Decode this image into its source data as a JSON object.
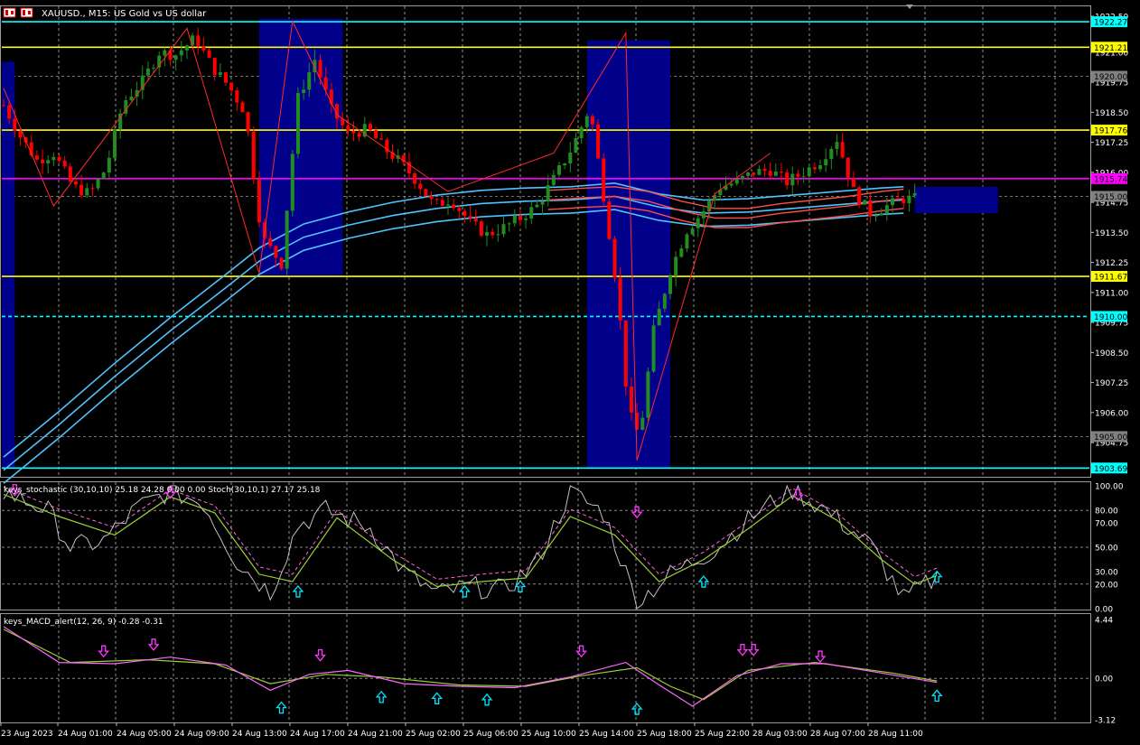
{
  "window": {
    "title": "XAUUSD., M15:  US Gold vs US dollar",
    "symbol_icon": "chart-window-icon"
  },
  "colors": {
    "background": "#000000",
    "grid": "#c0c0c0",
    "bull_candle": "#228b22",
    "bear_candle": "#ff0000",
    "zone": "#00008b",
    "level_yellow": "#ffff00",
    "level_magenta": "#ff00ff",
    "level_cyan": "#00ffff",
    "ema_red": "#ff4d4d",
    "ema_blue": "#4fc3ff",
    "zigzag": "#ff2a2a",
    "stoch_main": "#c0c0c0",
    "stoch_signal": "#9acd32",
    "stoch_slow": "#ff66cc",
    "macd_main": "#ff66ff",
    "macd_signal": "#9acd32",
    "arrow_up": "#00e5ff",
    "arrow_down": "#ff33ff"
  },
  "chart_data": [
    {
      "type": "line",
      "panel": "price",
      "title": "XAUUSD., M15:  US Gold vs US dollar",
      "ylim": [
        1903.4,
        1922.8
      ],
      "price_ticks": [
        "1922.50",
        "1921.00",
        "1919.75",
        "1918.50",
        "1917.25",
        "1916.00",
        "1914.75",
        "1913.50",
        "1912.25",
        "1911.00",
        "1909.75",
        "1908.50",
        "1907.25",
        "1906.00",
        "1904.75"
      ],
      "price_tick_values": [
        1922.5,
        1921.0,
        1919.75,
        1918.5,
        1917.25,
        1916.0,
        1914.75,
        1913.5,
        1912.25,
        1911.0,
        1909.75,
        1908.5,
        1907.25,
        1906.0,
        1904.75
      ],
      "levels": [
        {
          "price": 1922.27,
          "label": "1922.27",
          "color": "cyan",
          "style": "solid"
        },
        {
          "price": 1921.21,
          "label": "1921.21",
          "color": "yellow",
          "style": "solid"
        },
        {
          "price": 1920.0,
          "label": "1920.00",
          "color": "gray",
          "style": "dashed"
        },
        {
          "price": 1917.76,
          "label": "1917.76",
          "color": "yellow",
          "style": "solid"
        },
        {
          "price": 1915.74,
          "label": "1915.74",
          "color": "magenta",
          "style": "solid"
        },
        {
          "price": 1915.0,
          "label": "1915.00",
          "color": "gray",
          "style": "dashed"
        },
        {
          "price": 1911.67,
          "label": "1911.67",
          "color": "yellow",
          "style": "solid"
        },
        {
          "price": 1910.0,
          "label": "1910.00",
          "color": "cyan",
          "style": "dashed"
        },
        {
          "price": 1905.0,
          "label": "1905.00",
          "color": "gray",
          "style": "dashed"
        },
        {
          "price": 1903.69,
          "label": "1903.69",
          "color": "cyan",
          "style": "solid"
        }
      ],
      "close_path": [
        [
          0,
          1918.8
        ],
        [
          6,
          1917.5
        ],
        [
          12,
          1916.5
        ],
        [
          18,
          1916.8
        ],
        [
          25,
          1915.4
        ],
        [
          31,
          1915.1
        ],
        [
          37,
          1916.2
        ],
        [
          43,
          1918.9
        ],
        [
          50,
          1919.8
        ],
        [
          56,
          1921.0
        ],
        [
          62,
          1920.9
        ],
        [
          69,
          1921.6
        ],
        [
          75,
          1920.4
        ],
        [
          81,
          1919.6
        ],
        [
          87,
          1918.5
        ],
        [
          93,
          1913.3
        ],
        [
          100,
          1912.2
        ],
        [
          106,
          1919.1
        ],
        [
          112,
          1920.7
        ],
        [
          118,
          1918.6
        ],
        [
          124,
          1917.6
        ],
        [
          131,
          1917.8
        ],
        [
          137,
          1917.0
        ],
        [
          143,
          1916.4
        ],
        [
          149,
          1915.6
        ],
        [
          155,
          1914.6
        ],
        [
          161,
          1914.9
        ],
        [
          168,
          1913.9
        ],
        [
          174,
          1913.4
        ],
        [
          180,
          1913.7
        ],
        [
          186,
          1914.1
        ],
        [
          192,
          1914.6
        ],
        [
          199,
          1915.9
        ],
        [
          205,
          1917.1
        ],
        [
          211,
          1918.7
        ],
        [
          217,
          1914.3
        ],
        [
          221,
          1911.0
        ],
        [
          225,
          1906.0
        ],
        [
          229,
          1905.0
        ],
        [
          234,
          1909.4
        ],
        [
          240,
          1911.9
        ],
        [
          246,
          1913.6
        ],
        [
          252,
          1914.4
        ],
        [
          258,
          1915.4
        ],
        [
          264,
          1915.6
        ],
        [
          270,
          1916.0
        ],
        [
          276,
          1916.1
        ],
        [
          282,
          1915.6
        ],
        [
          288,
          1916.0
        ],
        [
          294,
          1916.5
        ],
        [
          300,
          1917.4
        ],
        [
          306,
          1915.2
        ],
        [
          312,
          1914.3
        ],
        [
          318,
          1914.6
        ],
        [
          324,
          1914.9
        ]
      ],
      "zigzag": [
        [
          0,
          1919.5
        ],
        [
          9,
          1914.6
        ],
        [
          33,
          1922.0
        ],
        [
          46,
          1911.8
        ],
        [
          52,
          1922.3
        ],
        [
          60,
          1918.4
        ],
        [
          80,
          1915.2
        ],
        [
          99,
          1916.8
        ],
        [
          112,
          1921.8
        ],
        [
          114,
          1904.0
        ],
        [
          128,
          1915.1
        ],
        [
          138,
          1916.8
        ]
      ],
      "zones": [
        {
          "from": 0,
          "to": 2,
          "top": 1920.6,
          "bottom": 1903.69
        },
        {
          "from": 46,
          "to": 61,
          "top": 1922.4,
          "bottom": 1911.7
        },
        {
          "from": 105,
          "to": 120,
          "top": 1921.5,
          "bottom": 1903.69
        },
        {
          "from": 164,
          "to": 179,
          "top": 1915.4,
          "bottom": 1914.3
        }
      ],
      "ema_red": [
        [
          98,
          1914.85
        ],
        [
          105,
          1914.95
        ],
        [
          110,
          1915.0
        ],
        [
          116,
          1914.8
        ],
        [
          122,
          1914.4
        ],
        [
          128,
          1914.1
        ],
        [
          134,
          1914.1
        ],
        [
          140,
          1914.3
        ],
        [
          146,
          1914.45
        ],
        [
          152,
          1914.6
        ],
        [
          158,
          1914.8
        ],
        [
          162,
          1914.9
        ]
      ],
      "ema_blue": [
        [
          0,
          1903.6
        ],
        [
          10,
          1905.5
        ],
        [
          20,
          1907.5
        ],
        [
          30,
          1909.4
        ],
        [
          40,
          1911.2
        ],
        [
          46,
          1912.3
        ],
        [
          54,
          1913.3
        ],
        [
          62,
          1913.8
        ],
        [
          70,
          1914.2
        ],
        [
          78,
          1914.5
        ],
        [
          86,
          1914.7
        ],
        [
          94,
          1914.8
        ],
        [
          102,
          1914.85
        ],
        [
          110,
          1915.0
        ],
        [
          118,
          1914.55
        ],
        [
          126,
          1914.3
        ],
        [
          134,
          1914.35
        ],
        [
          142,
          1914.5
        ],
        [
          150,
          1914.65
        ],
        [
          158,
          1914.8
        ],
        [
          162,
          1914.85
        ]
      ]
    },
    {
      "type": "line",
      "panel": "stochastic",
      "title": "keys_stochastic (30,10,10) 25.18 24.28 0.00 0.00 Stoch(30,10,1) 27.17 25.18",
      "ylim": [
        0,
        100
      ],
      "ticks": [
        "100.00",
        "80.00",
        "70.00",
        "50.00",
        "30.00",
        "20.00",
        "0.00"
      ],
      "tick_values": [
        100,
        80,
        70,
        50,
        30,
        20,
        0
      ],
      "levels": [
        80,
        50,
        20
      ],
      "main": [
        [
          0,
          95
        ],
        [
          8,
          80
        ],
        [
          12,
          50
        ],
        [
          18,
          55
        ],
        [
          24,
          82
        ],
        [
          30,
          96
        ],
        [
          36,
          86
        ],
        [
          42,
          38
        ],
        [
          48,
          13
        ],
        [
          53,
          68
        ],
        [
          58,
          80
        ],
        [
          66,
          66
        ],
        [
          72,
          30
        ],
        [
          78,
          12
        ],
        [
          84,
          18
        ],
        [
          90,
          15
        ],
        [
          96,
          38
        ],
        [
          102,
          95
        ],
        [
          108,
          78
        ],
        [
          114,
          5
        ],
        [
          120,
          28
        ],
        [
          128,
          48
        ],
        [
          136,
          80
        ],
        [
          142,
          97
        ],
        [
          148,
          80
        ],
        [
          156,
          52
        ],
        [
          162,
          8
        ],
        [
          168,
          25
        ]
      ],
      "signal": [
        [
          0,
          93
        ],
        [
          10,
          75
        ],
        [
          20,
          60
        ],
        [
          30,
          91
        ],
        [
          38,
          78
        ],
        [
          46,
          28
        ],
        [
          52,
          22
        ],
        [
          60,
          74
        ],
        [
          70,
          40
        ],
        [
          78,
          18
        ],
        [
          86,
          22
        ],
        [
          94,
          25
        ],
        [
          102,
          75
        ],
        [
          110,
          60
        ],
        [
          118,
          22
        ],
        [
          126,
          40
        ],
        [
          134,
          65
        ],
        [
          142,
          92
        ],
        [
          150,
          72
        ],
        [
          158,
          40
        ],
        [
          164,
          20
        ],
        [
          168,
          27
        ]
      ],
      "up_arrows": [
        [
          53,
          14
        ],
        [
          83,
          14
        ],
        [
          93,
          18
        ],
        [
          126,
          22
        ],
        [
          168,
          26
        ]
      ],
      "down_arrows": [
        [
          2,
          98
        ],
        [
          30,
          96
        ],
        [
          114,
          80
        ],
        [
          143,
          94
        ]
      ]
    },
    {
      "type": "line",
      "panel": "macd",
      "title": "keys_MACD_alert(12, 26, 9) -0.28 -0.31",
      "ylim": [
        -3.12,
        4.44
      ],
      "ticks": [
        "4.44",
        "0.00",
        "-3.12"
      ],
      "tick_values": [
        4.44,
        0.0,
        -3.12
      ],
      "main": [
        [
          0,
          3.9
        ],
        [
          10,
          1.2
        ],
        [
          20,
          1.1
        ],
        [
          30,
          1.6
        ],
        [
          40,
          1.0
        ],
        [
          48,
          -0.9
        ],
        [
          55,
          0.3
        ],
        [
          62,
          0.6
        ],
        [
          72,
          -0.4
        ],
        [
          82,
          -0.6
        ],
        [
          92,
          -0.7
        ],
        [
          102,
          0.1
        ],
        [
          112,
          1.2
        ],
        [
          118,
          -0.5
        ],
        [
          124,
          -2.1
        ],
        [
          132,
          0.2
        ],
        [
          140,
          1.1
        ],
        [
          148,
          1.1
        ],
        [
          158,
          0.4
        ],
        [
          168,
          -0.3
        ]
      ],
      "signal": [
        [
          0,
          3.7
        ],
        [
          12,
          1.2
        ],
        [
          26,
          1.4
        ],
        [
          38,
          1.1
        ],
        [
          48,
          -0.4
        ],
        [
          58,
          0.3
        ],
        [
          68,
          0.1
        ],
        [
          82,
          -0.5
        ],
        [
          94,
          -0.6
        ],
        [
          104,
          0.2
        ],
        [
          114,
          0.8
        ],
        [
          120,
          -0.6
        ],
        [
          126,
          -1.6
        ],
        [
          134,
          0.6
        ],
        [
          146,
          1.2
        ],
        [
          160,
          0.4
        ],
        [
          168,
          -0.2
        ]
      ],
      "up_arrows": [
        [
          50,
          -1.8
        ],
        [
          68,
          -1.0
        ],
        [
          78,
          -1.1
        ],
        [
          87,
          -1.2
        ],
        [
          114,
          -1.9
        ],
        [
          168,
          -0.9
        ]
      ],
      "down_arrows": [
        [
          18,
          1.5
        ],
        [
          27,
          2.0
        ],
        [
          57,
          1.2
        ],
        [
          104,
          1.5
        ],
        [
          133,
          1.6
        ],
        [
          135,
          1.6
        ],
        [
          147,
          1.1
        ]
      ]
    }
  ],
  "time_axis": {
    "labels": [
      "23 Aug 2023",
      "24 Aug 01:00",
      "24 Aug 05:00",
      "24 Aug 09:00",
      "24 Aug 13:00",
      "24 Aug 17:00",
      "24 Aug 21:00",
      "25 Aug 02:00",
      "25 Aug 06:00",
      "25 Aug 10:00",
      "25 Aug 14:00",
      "25 Aug 18:00",
      "25 Aug 22:00",
      "28 Aug 03:00",
      "28 Aug 07:00",
      "28 Aug 11:00"
    ]
  }
}
